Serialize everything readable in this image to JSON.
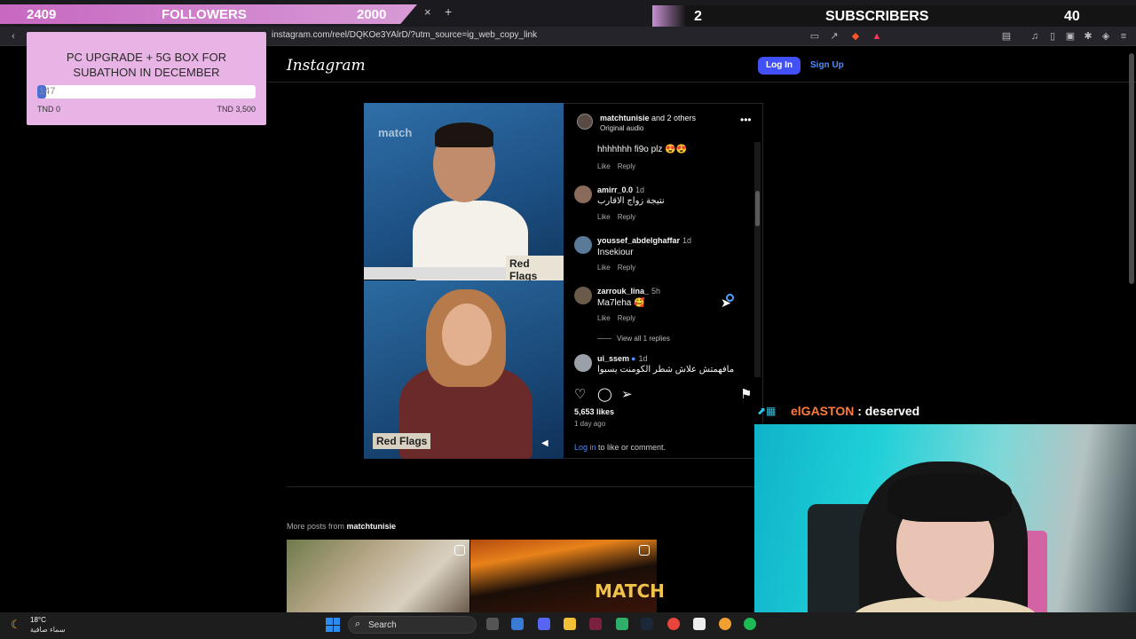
{
  "overlay": {
    "followers": {
      "current": "2409",
      "label": "FOLLOWERS",
      "goal": "2000"
    },
    "subscribers": {
      "current": "2",
      "label": "SUBSCRIBERS",
      "goal": "40"
    },
    "donation_goal": {
      "title_line1": "PC UPGRADE + 5G BOX FOR",
      "title_line2": "SUBATHON IN DECEMBER",
      "current": "147",
      "progress_fraction": 0.042,
      "min_label": "TND 0",
      "max_label": "TND 3,500"
    },
    "chat": {
      "user": "elGASTON",
      "message": " : deserved"
    }
  },
  "browser": {
    "close_tab": "×",
    "new_tab": "+",
    "url": "instagram.com/reel/DQKOe3YAlrD/?utm_source=ig_web_copy_link"
  },
  "instagram": {
    "logo": "Instagram",
    "login_label": "Log In",
    "signup_label": "Sign Up",
    "video": {
      "watermark": "match",
      "tag_top": "Red Flags",
      "tag_bottom": "Red Flags"
    },
    "post_header": {
      "author": "matchtunisie",
      "author_suffix": " and 2 others",
      "audio": "Original audio"
    },
    "comments": [
      {
        "user": "",
        "time": "",
        "text": "hhhhhhh fi9o plz 😍😍",
        "actions": [
          "Like",
          "Reply"
        ]
      },
      {
        "user": "amirr_0.0",
        "time": "1d",
        "text": "نتيجة زواج الاقارب",
        "actions": [
          "Like",
          "Reply"
        ]
      },
      {
        "user": "youssef_abdelghaffar",
        "time": "1d",
        "text": "Insekiour",
        "actions": [
          "Like",
          "Reply"
        ]
      },
      {
        "user": "zarrouk_lina_",
        "time": "5h",
        "text": "Ma7leha 🥰",
        "actions": [
          "Like",
          "Reply"
        ]
      },
      {
        "user": "ui_ssem",
        "time": "1d",
        "text": "مافهمتش علاش شطر الكومنت يسبوا",
        "actions": []
      }
    ],
    "view_replies": "View all 1 replies",
    "likes": "5,653 likes",
    "ago": "1 day ago",
    "login_cta_link": "Log in",
    "login_cta_rest": " to like or comment.",
    "more_posts_prefix": "More posts from ",
    "more_posts_author": "matchtunisie",
    "thumb2_text": "MATCH"
  },
  "taskbar": {
    "temperature": "18°C",
    "weather": "سماء صافية",
    "search_label": "Search"
  },
  "colors": {
    "ig_blue": "#4150f7",
    "overlay_pink": "#e8b3e5",
    "progress_blue": "#4d6fd2"
  }
}
